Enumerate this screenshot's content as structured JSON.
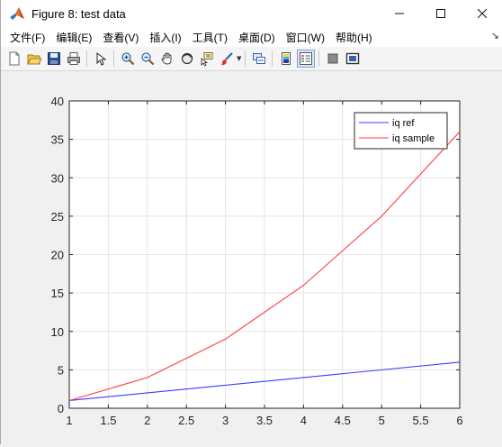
{
  "window": {
    "title": "Figure 8: test data",
    "minimize_glyph": "—",
    "maximize_glyph": "☐",
    "close_glyph": "✕"
  },
  "menu": {
    "items": [
      {
        "label": "文件(F)"
      },
      {
        "label": "编辑(E)"
      },
      {
        "label": "查看(V)"
      },
      {
        "label": "插入(I)"
      },
      {
        "label": "工具(T)"
      },
      {
        "label": "桌面(D)"
      },
      {
        "label": "窗口(W)"
      },
      {
        "label": "帮助(H)"
      }
    ],
    "overflow_arrow": "↘"
  },
  "toolbar": {
    "buttons": [
      {
        "icon": "new-figure-icon"
      },
      {
        "icon": "open-file-icon"
      },
      {
        "icon": "save-icon"
      },
      {
        "icon": "print-icon"
      },
      {
        "icon": "edit-plot-icon"
      },
      {
        "icon": "zoom-in-icon"
      },
      {
        "icon": "zoom-out-icon"
      },
      {
        "icon": "pan-icon"
      },
      {
        "icon": "rotate-3d-icon"
      },
      {
        "icon": "data-cursor-icon"
      },
      {
        "icon": "brush-icon"
      },
      {
        "icon": "link-plot-icon"
      },
      {
        "icon": "insert-colorbar-icon"
      },
      {
        "icon": "insert-legend-icon"
      },
      {
        "icon": "hide-plot-tools-icon"
      },
      {
        "icon": "show-plot-tools-icon"
      }
    ],
    "active_button": "insert-legend-icon"
  },
  "chart_data": {
    "type": "line",
    "title": "",
    "xlabel": "",
    "ylabel": "",
    "xlim": [
      1,
      6
    ],
    "ylim": [
      0,
      40
    ],
    "x_ticks": [
      "1",
      "1.5",
      "2",
      "2.5",
      "3",
      "3.5",
      "4",
      "4.5",
      "5",
      "5.5",
      "6"
    ],
    "y_ticks": [
      "0",
      "5",
      "10",
      "15",
      "20",
      "25",
      "30",
      "35",
      "40"
    ],
    "grid": true,
    "legend_position": "top-right",
    "series": [
      {
        "name": "iq ref",
        "color": "#3b3bff",
        "x": [
          1,
          2,
          3,
          4,
          5,
          6
        ],
        "y": [
          1,
          2,
          3,
          4,
          5,
          6
        ]
      },
      {
        "name": "iq sample",
        "color": "#ff3b3b",
        "x": [
          1,
          2,
          3,
          4,
          5,
          6
        ],
        "y": [
          1,
          4,
          9,
          16,
          25,
          36
        ]
      }
    ]
  }
}
